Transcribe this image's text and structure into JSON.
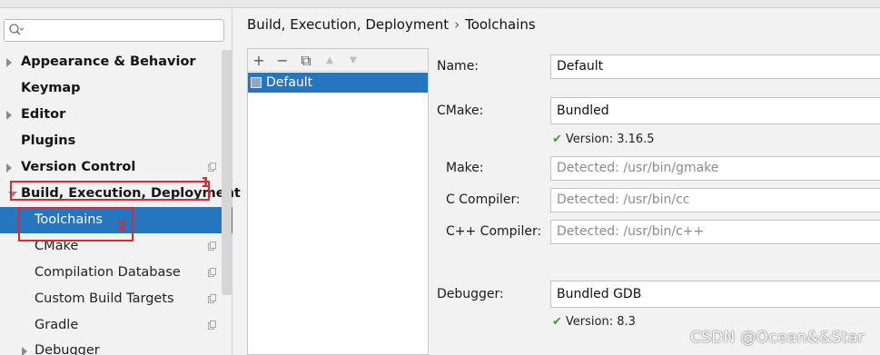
{
  "search": {
    "placeholder": ""
  },
  "tree": {
    "appearance": "Appearance & Behavior",
    "keymap": "Keymap",
    "editor": "Editor",
    "plugins": "Plugins",
    "version_control": "Version Control",
    "build": "Build, Execution, Deployment",
    "toolchains": "Toolchains",
    "cmake": "CMake",
    "compilation_db": "Compilation Database",
    "custom_targets": "Custom Build Targets",
    "gradle": "Gradle",
    "debugger": "Debugger"
  },
  "annotations": {
    "box1": "1",
    "box2": "2",
    "color": "#e0292f"
  },
  "breadcrumb": {
    "parent": "Build, Execution, Deployment",
    "separator": "›",
    "current": "Toolchains"
  },
  "toolbar": {
    "add": "+",
    "remove": "−",
    "copy": "⧉",
    "up": "▲",
    "down": "▼"
  },
  "toolchains": [
    {
      "name": "Default"
    }
  ],
  "form": {
    "name_label": "Name:",
    "name_value": "Default",
    "cmake_label": "CMake:",
    "cmake_value": "Bundled",
    "cmake_version": "Version: 3.16.5",
    "make_label": "Make:",
    "make_placeholder": "Detected: /usr/bin/gmake",
    "c_label": "C Compiler:",
    "c_placeholder": "Detected: /usr/bin/cc",
    "cpp_label": "C++ Compiler:",
    "cpp_placeholder": "Detected: /usr/bin/c++",
    "debugger_label": "Debugger:",
    "debugger_value": "Bundled GDB",
    "debugger_version": "Version: 8.3"
  },
  "watermark": "CSDN @Ocean&&Star",
  "colors": {
    "selection": "#2675bf",
    "check": "#3d9b3d"
  }
}
